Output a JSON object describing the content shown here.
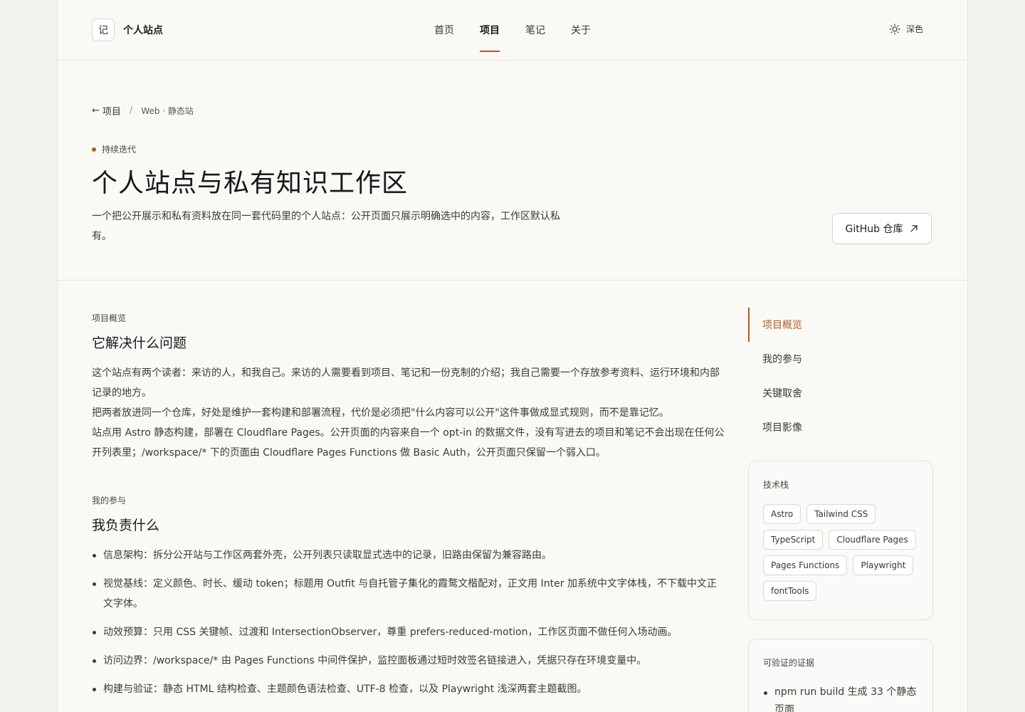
{
  "header": {
    "logo_char": "记",
    "site_name": "个人站点",
    "nav": [
      {
        "label": "首页",
        "active": false
      },
      {
        "label": "项目",
        "active": true
      },
      {
        "label": "笔记",
        "active": false
      },
      {
        "label": "关于",
        "active": false
      }
    ],
    "theme_label": "深色"
  },
  "hero": {
    "breadcrumb_back": "项目",
    "breadcrumb_sep": "/",
    "breadcrumb_current": "Web · 静态站",
    "status": "持续迭代",
    "title": "个人站点与私有知识工作区",
    "intro": "一个把公开展示和私有资料放在同一套代码里的个人站点：公开页面只展示明确选中的内容，工作区默认私有。",
    "github_label": "GitHub 仓库"
  },
  "overview": {
    "label": "项目概览",
    "title": "它解决什么问题",
    "paragraphs": [
      "这个站点有两个读者：来访的人，和我自己。来访的人需要看到项目、笔记和一份克制的介绍；我自己需要一个存放参考资料、运行环境和内部记录的地方。",
      "把两者放进同一个仓库，好处是维护一套构建和部署流程，代价是必须把\"什么内容可以公开\"这件事做成显式规则，而不是靠记忆。",
      "站点用 Astro 静态构建，部署在 Cloudflare Pages。公开页面的内容来自一个 opt-in 的数据文件，没有写进去的项目和笔记不会出现在任何公开列表里；/workspace/* 下的页面由 Cloudflare Pages Functions 做 Basic Auth，公开页面只保留一个弱入口。"
    ]
  },
  "role": {
    "label": "我的参与",
    "title": "我负责什么",
    "bullets": [
      "信息架构：拆分公开站与工作区两套外壳，公开列表只读取显式选中的记录，旧路由保留为兼容路由。",
      "视觉基线：定义颜色、时长、缓动 token；标题用 Outfit 与自托管子集化的霞鹜文楷配对，正文用 Inter 加系统中文字体栈，不下载中文正文字体。",
      "动效预算：只用 CSS 关键帧、过渡和 IntersectionObserver，尊重 prefers-reduced-motion，工作区页面不做任何入场动画。",
      "访问边界：/workspace/* 由 Pages Functions 中间件保护，监控面板通过短时效签名链接进入，凭据只存在环境变量中。",
      "构建与验证：静态 HTML 结构检查、主题颜色语法检查、UTF-8 检查，以及 Playwright 浅深两套主题截图。"
    ]
  },
  "toc": [
    {
      "label": "项目概览",
      "active": true
    },
    {
      "label": "我的参与",
      "active": false
    },
    {
      "label": "关键取舍",
      "active": false
    },
    {
      "label": "项目影像",
      "active": false
    }
  ],
  "tech_stack": {
    "title": "技术栈",
    "items": [
      "Astro",
      "Tailwind CSS",
      "TypeScript",
      "Cloudflare Pages",
      "Pages Functions",
      "Playwright",
      "fontTools"
    ]
  },
  "evidence": {
    "title": "可验证的证据",
    "items": [
      "npm run build 生成 33 个静态页面"
    ]
  }
}
